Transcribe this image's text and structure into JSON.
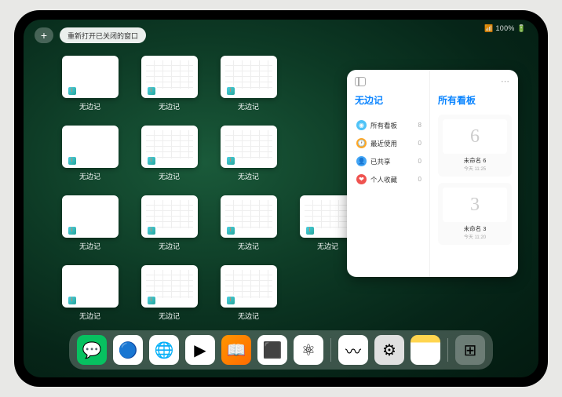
{
  "status": {
    "text": "📶 100% 🔋"
  },
  "top": {
    "plus": "+",
    "reopen": "重新打开已关闭的窗口"
  },
  "thumbs": {
    "label": "无边记",
    "items": [
      {
        "style": "blank"
      },
      {
        "style": "grid"
      },
      {
        "style": "grid"
      },
      {
        "style": "blank"
      },
      {
        "style": "grid"
      },
      {
        "style": "grid"
      },
      {
        "style": "blank"
      },
      {
        "style": "grid"
      },
      {
        "style": "grid"
      },
      {
        "style": "grid"
      },
      {
        "style": "blank"
      },
      {
        "style": "grid"
      },
      {
        "style": "grid"
      }
    ]
  },
  "panel": {
    "title_left": "无边记",
    "title_right": "所有看板",
    "menu": [
      {
        "icon": "◉",
        "color": "#4fc3f7",
        "label": "所有看板",
        "count": "8"
      },
      {
        "icon": "🕐",
        "color": "#ffa726",
        "label": "最近使用",
        "count": "0"
      },
      {
        "icon": "👤",
        "color": "#42a5f5",
        "label": "已共享",
        "count": "0"
      },
      {
        "icon": "❤",
        "color": "#ef5350",
        "label": "个人收藏",
        "count": "0"
      }
    ],
    "boards": [
      {
        "glyph": "6",
        "name": "未命名 6",
        "date": "今天 11:25"
      },
      {
        "glyph": "3",
        "name": "未命名 3",
        "date": "今天 11:20"
      }
    ]
  },
  "dock": [
    {
      "name": "wechat",
      "bg": "#07c160",
      "glyph": "💬"
    },
    {
      "name": "quark",
      "bg": "#fff",
      "glyph": "🔵"
    },
    {
      "name": "qqbrowser",
      "bg": "#fff",
      "glyph": "🌐"
    },
    {
      "name": "tencent-video",
      "bg": "#fff",
      "glyph": "▶"
    },
    {
      "name": "books",
      "bg": "linear-gradient(135deg,#ff9500,#ff6b00)",
      "glyph": "📖"
    },
    {
      "name": "app-a",
      "bg": "#fff",
      "glyph": "⬛"
    },
    {
      "name": "app-b",
      "bg": "#fff",
      "glyph": "⚛"
    },
    {
      "name": "freeform",
      "bg": "#fff",
      "glyph": "〰"
    },
    {
      "name": "settings",
      "bg": "#e0e0e0",
      "glyph": "⚙"
    },
    {
      "name": "notes",
      "bg": "linear-gradient(180deg,#ffd54f 25%,#fff 25%)",
      "glyph": ""
    },
    {
      "name": "app-library",
      "bg": "rgba(255,255,255,0.25)",
      "glyph": "⊞"
    }
  ]
}
